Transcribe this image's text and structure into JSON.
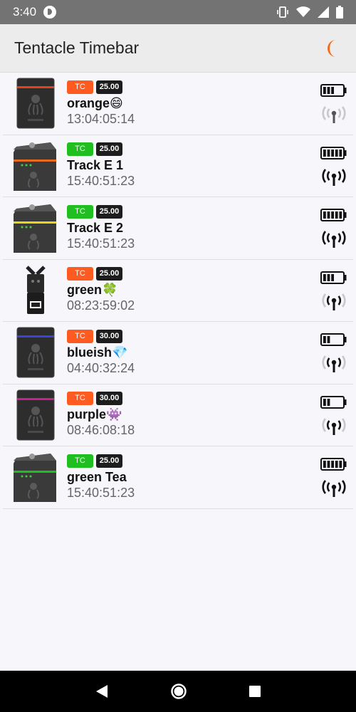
{
  "status": {
    "time": "3:40"
  },
  "app": {
    "title": "Tentacle Timebar"
  },
  "devices": [
    {
      "tc": "TC",
      "tc_color": "#ff5a1f",
      "fps": "25.00",
      "name": "orange😄",
      "timecode": "13:04:05:14",
      "stripe": "#e8401c",
      "device": "sync-e",
      "battery": 3,
      "signal": "weak"
    },
    {
      "tc": "TC",
      "tc_color": "#1fbf1f",
      "fps": "25.00",
      "name": "Track E 1",
      "timecode": "15:40:51:23",
      "stripe": "#e86a1c",
      "device": "track-e",
      "battery": 5,
      "signal": "strong"
    },
    {
      "tc": "TC",
      "tc_color": "#1fbf1f",
      "fps": "25.00",
      "name": "Track E 2",
      "timecode": "15:40:51:23",
      "stripe": "#e6d61c",
      "device": "track-e",
      "battery": 5,
      "signal": "strong"
    },
    {
      "tc": "TC",
      "tc_color": "#ff5a1f",
      "fps": "25.00",
      "name": "green🍀",
      "timecode": "08:23:59:02",
      "stripe": "#1fbf1f",
      "device": "recorder",
      "battery": 3,
      "signal": "medium"
    },
    {
      "tc": "TC",
      "tc_color": "#ff5a1f",
      "fps": "30.00",
      "name": "blueish💎",
      "timecode": "04:40:32:24",
      "stripe": "#3a45d8",
      "device": "sync-e",
      "battery": 2,
      "signal": "medium"
    },
    {
      "tc": "TC",
      "tc_color": "#ff5a1f",
      "fps": "30.00",
      "name": "purple👾",
      "timecode": "08:46:08:18",
      "stripe": "#c82090",
      "device": "sync-e",
      "battery": 2,
      "signal": "medium"
    },
    {
      "tc": "TC",
      "tc_color": "#1fbf1f",
      "fps": "25.00",
      "name": "green Tea",
      "timecode": "15:40:51:23",
      "stripe": "#1fbf1f",
      "device": "track-e",
      "battery": 5,
      "signal": "strong"
    }
  ]
}
